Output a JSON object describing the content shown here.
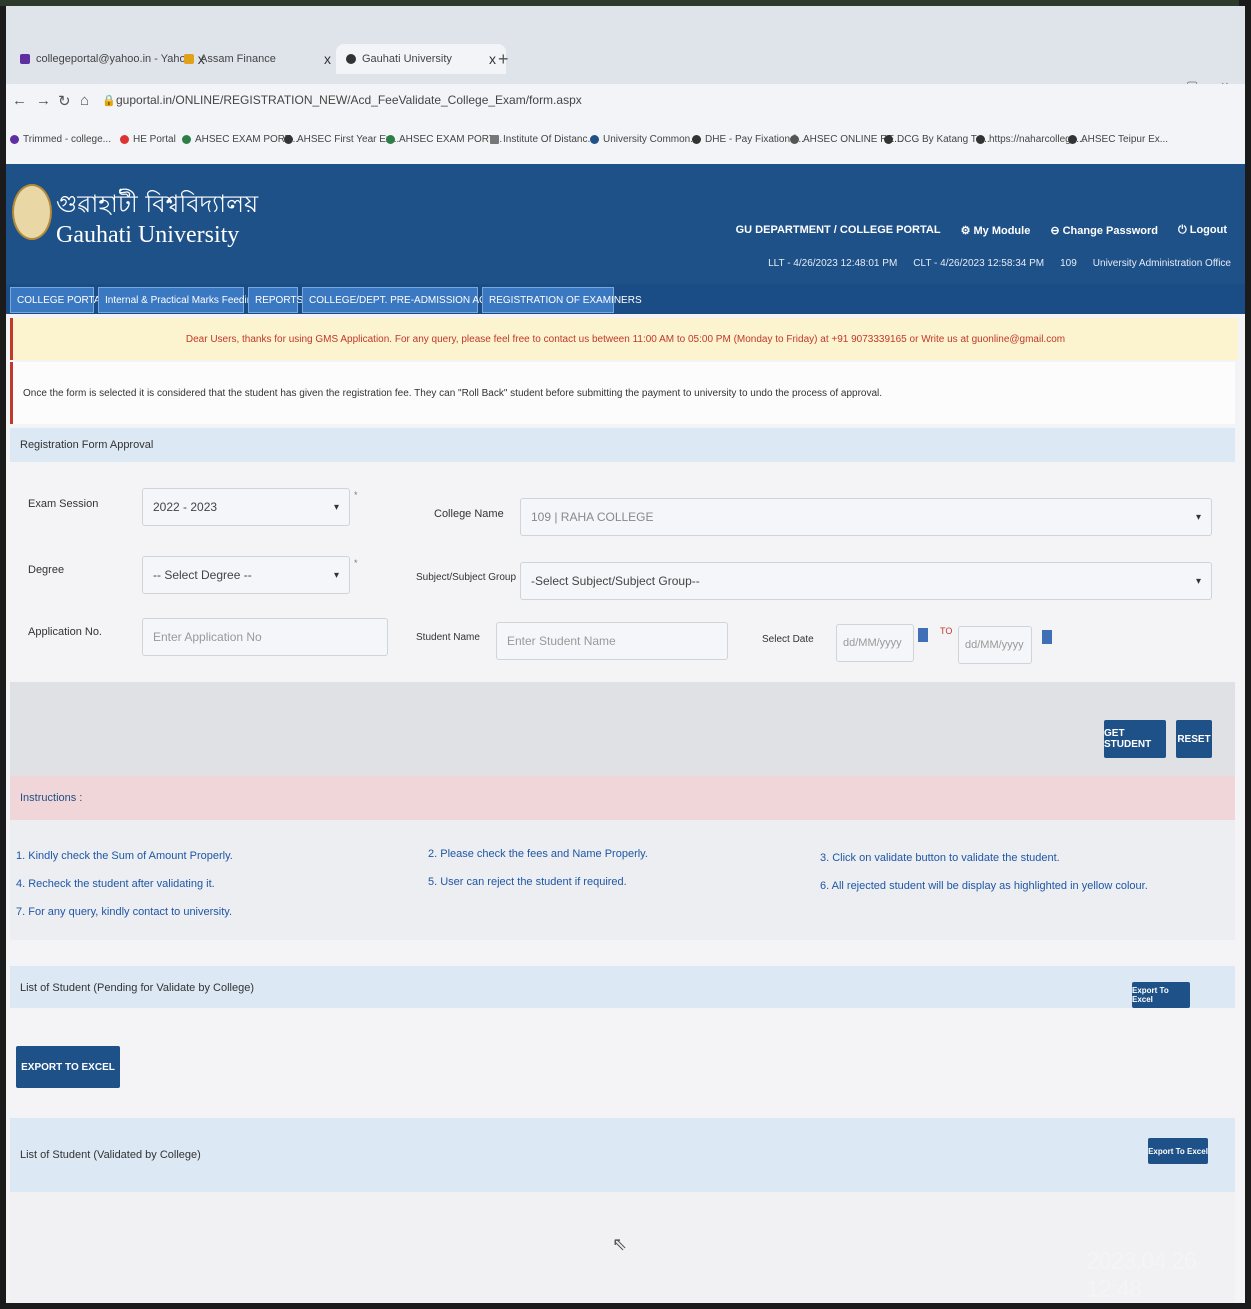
{
  "browser": {
    "tabs": [
      {
        "label": "collegeportal@yahoo.in - Yahoo",
        "close": "x"
      },
      {
        "label": "Assam Finance",
        "close": ""
      },
      {
        "label": "Gauhati University",
        "close": "x"
      }
    ],
    "new_tab": "+",
    "window_controls": [
      "–",
      "▢",
      "×"
    ],
    "url": "guportal.in/ONLINE/REGISTRATION_NEW/Acd_FeeValidate_College_Exam/form.aspx",
    "bookmarks": [
      "Trimmed - college...",
      "HE Portal",
      "AHSEC EXAM PORT...",
      "AHSEC First Year Ex...",
      "AHSEC EXAM PORT...",
      "Institute Of Distanc...",
      "University Common...",
      "DHE - Pay Fixation f...",
      "AHSEC ONLINE RE...",
      "DCG By Katang Te...",
      "https://naharcollege...",
      "AHSEC Teipur Ex..."
    ]
  },
  "header": {
    "title_bn": "গুৱাহাটী বিশ্ববিদ্যালয়",
    "title_en": "Gauhati University",
    "links": [
      "GU DEPARTMENT / COLLEGE PORTAL",
      "My Module",
      "Change Password",
      "Logout"
    ],
    "meta": [
      "LLT - 4/26/2023 12:48:01 PM",
      "CLT - 4/26/2023 12:58:34 PM",
      "109",
      "University Administration Office"
    ]
  },
  "menu": [
    "COLLEGE PORTAL",
    "Internal & Practical Marks Feeding",
    "REPORTS",
    "COLLEGE/DEPT. PRE-ADMISSION ACTIVITY",
    "REGISTRATION OF EXAMINERS"
  ],
  "notice": "Dear Users, thanks for using GMS Application. For any query, please feel free to contact us between 11:00 AM to 05:00 PM (Monday to Friday) at +91 9073339165 or Write us at guonline@gmail.com",
  "rollback_note": "Once the form is selected it is considered that the student has given the registration fee. They can \"Roll Back\" student before submitting the payment to university to undo the process of approval.",
  "form": {
    "section_title": "Registration Form Approval",
    "exam_session_label": "Exam Session",
    "exam_session_value": "2022 - 2023",
    "college_name_label": "College Name",
    "college_name_value": "109 | RAHA COLLEGE",
    "degree_label": "Degree",
    "degree_value": "-- Select Degree --",
    "subject_label": "Subject/Subject Group",
    "subject_value": "-Select Subject/Subject Group--",
    "application_label": "Application No.",
    "application_placeholder": "Enter Application No",
    "student_name_label": "Student Name",
    "student_name_placeholder": "Enter Student Name",
    "select_date_label": "Select Date",
    "date_from_placeholder": "dd/MM/yyyy",
    "date_to_label": "TO",
    "date_to_placeholder": "dd/MM/yyyy",
    "required_mark": "*"
  },
  "buttons": {
    "get_student": "GET STUDENT",
    "reset": "RESET"
  },
  "instructions": {
    "title": "Instructions :",
    "items": [
      "1. Kindly check the Sum of Amount Properly.",
      "2. Please check the fees and Name Properly.",
      "3. Click on validate button to validate the student.",
      "4. Recheck the student after validating it.",
      "5. User can reject the student if required.",
      "6. All rejected student will be display as highlighted in yellow colour.",
      "7. For any query, kindly contact to university."
    ]
  },
  "pending_list": {
    "title": "List of Student (Pending for Validate by College)",
    "export_small": "Export To Excel",
    "export_big": "EXPORT TO EXCEL"
  },
  "validated_list": {
    "title": "List of Student (Validated by College)",
    "export_small": "Export To Excel"
  },
  "photo_timestamp": "2023.04.26 12:48"
}
